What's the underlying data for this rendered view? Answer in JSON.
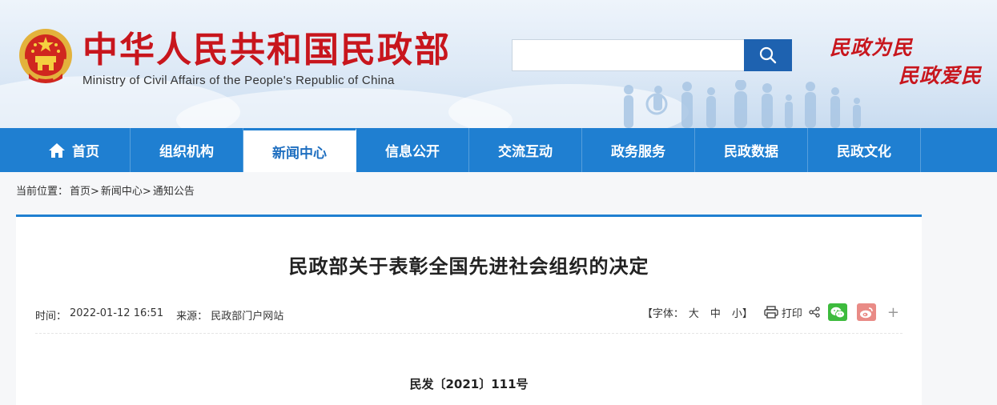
{
  "header": {
    "title": "中华人民共和国民政部",
    "subtitle": "Ministry of Civil Affairs of the People's Republic of China",
    "search": {
      "placeholder": "",
      "value": ""
    },
    "slogan_line1": "民政为民",
    "slogan_line2": "民政爱民"
  },
  "nav": {
    "items": [
      {
        "label": "首页",
        "icon": "home-icon"
      },
      {
        "label": "组织机构"
      },
      {
        "label": "新闻中心",
        "active": true
      },
      {
        "label": "信息公开"
      },
      {
        "label": "交流互动"
      },
      {
        "label": "政务服务"
      },
      {
        "label": "民政数据"
      },
      {
        "label": "民政文化"
      }
    ]
  },
  "breadcrumb": {
    "prefix": "当前位置：",
    "items": [
      "首页>",
      "新闻中心>",
      "通知公告"
    ]
  },
  "article": {
    "title": "民政部关于表彰全国先进社会组织的决定",
    "time_label": "时间：",
    "time": "2022-01-12 16:51",
    "source_label": "来源：",
    "source": "民政部门户网站",
    "font_size_label": "【字体：",
    "font_large": "大",
    "font_medium": "中",
    "font_small": "小",
    "font_close": "】",
    "print_label": "打印",
    "plus": "+",
    "doc_number": "民发〔2021〕111号"
  },
  "colors": {
    "brand_red": "#c8161d",
    "nav_blue": "#1f7fd1",
    "search_blue": "#1e62b0"
  }
}
